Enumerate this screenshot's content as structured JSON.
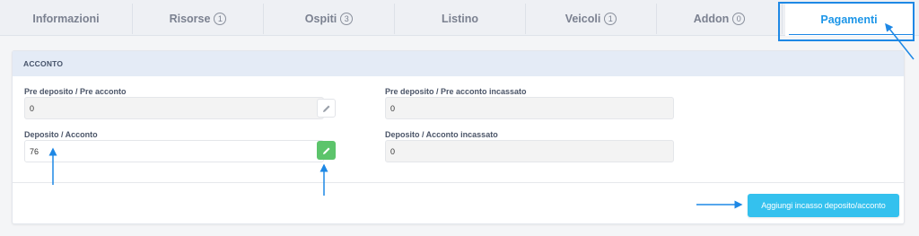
{
  "tabs": [
    {
      "label": "Informazioni",
      "badge": ""
    },
    {
      "label": "Risorse",
      "badge": "1"
    },
    {
      "label": "Ospiti",
      "badge": "3"
    },
    {
      "label": "Listino",
      "badge": ""
    },
    {
      "label": "Veicoli",
      "badge": "1"
    },
    {
      "label": "Addon",
      "badge": "0"
    },
    {
      "label": "Pagamenti",
      "badge": "",
      "active": true
    }
  ],
  "section": {
    "title": "ACCONTO",
    "pre_deposit": {
      "label": "Pre deposito / Pre acconto",
      "value": "0"
    },
    "pre_deposit_collected": {
      "label": "Pre deposito / Pre acconto incassato",
      "value": "0"
    },
    "deposit": {
      "label": "Deposito / Acconto",
      "value": "76"
    },
    "deposit_collected": {
      "label": "Deposito / Acconto incassato",
      "value": "0"
    }
  },
  "actions": {
    "add_deposit_label": "Aggiungi incasso deposito/acconto"
  },
  "colors": {
    "accent": "#1d96e8",
    "green": "#5cc46b",
    "action": "#34c1ee",
    "annotation": "#1e88e5"
  },
  "icons": {
    "edit": "pencil-icon"
  }
}
